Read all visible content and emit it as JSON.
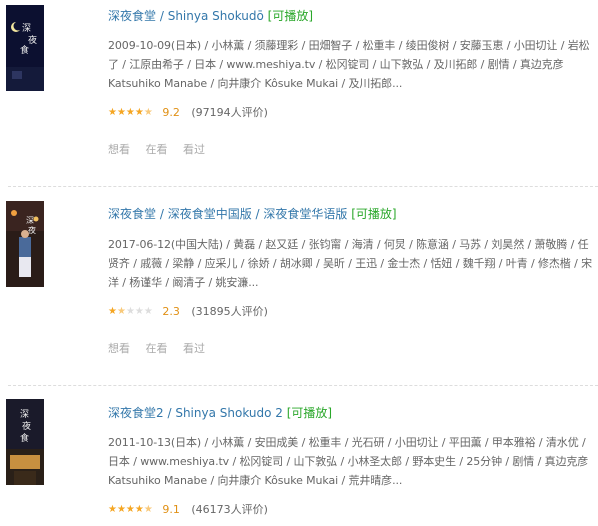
{
  "items": [
    {
      "title": "深夜食堂",
      "alt_titles": [
        "Shinya Shokudō"
      ],
      "playable": "[可播放]",
      "meta": "2009-10-09(日本) / 小林薫 / 须藤理彩 / 田畑智子 / 松重丰 / 绫田俊树 / 安藤玉恵 / 小田切让 / 岩松了 / 江原由希子 / 日本 / www.meshiya.tv / 松冈锭司 / 山下敦弘 / 及川拓郎 / 剧情 / 真边克彦 Katsuhiko Manabe / 向井康介 Kôsuke Mukai / 及川拓郎...",
      "rating_stars": 4.5,
      "score": "9.2",
      "votes": "(97194人评价)",
      "actions": [
        "想看",
        "在看",
        "看过"
      ]
    },
    {
      "title": "深夜食堂",
      "alt_titles": [
        "深夜食堂中国版",
        "深夜食堂华语版"
      ],
      "playable": "[可播放]",
      "meta": "2017-06-12(中国大陆) / 黄磊 / 赵又廷 / 张钧甯 / 海清 / 何炅 / 陈意涵 / 马苏 / 刘昊然 / 萧敬腾 / 任贤齐 / 戚薇 / 梁静 / 应采儿 / 徐娇 / 胡冰卿 / 吴昕 / 王迅 / 金士杰 / 恬妞 / 魏千翔 / 叶青 / 修杰楷 / 宋洋 / 杨谨华 / 阚清子 / 姚安濂...",
      "rating_stars": 1.5,
      "score": "2.3",
      "votes": "(31895人评价)",
      "actions": [
        "想看",
        "在看",
        "看过"
      ]
    },
    {
      "title": "深夜食堂2",
      "alt_titles": [
        "Shinya Shokudo 2"
      ],
      "playable": "[可播放]",
      "meta": "2011-10-13(日本) / 小林薫 / 安田成美 / 松重丰 / 光石研 / 小田切让 / 平田薫 / 甲本雅裕 / 清水优 / 日本 / www.meshiya.tv / 松冈锭司 / 山下敦弘 / 小林圣太郎 / 野本史生 / 25分钟 / 剧情 / 真边克彦 Katsuhiko Manabe / 向井康介 Kôsuke Mukai / 荒井晴彦...",
      "rating_stars": 4.5,
      "score": "9.1",
      "votes": "(46173人评价)",
      "actions": []
    }
  ],
  "colors": {
    "link": "#3377aa",
    "play": "#2aa72a",
    "star": "#f5a623",
    "score": "#e09015"
  }
}
